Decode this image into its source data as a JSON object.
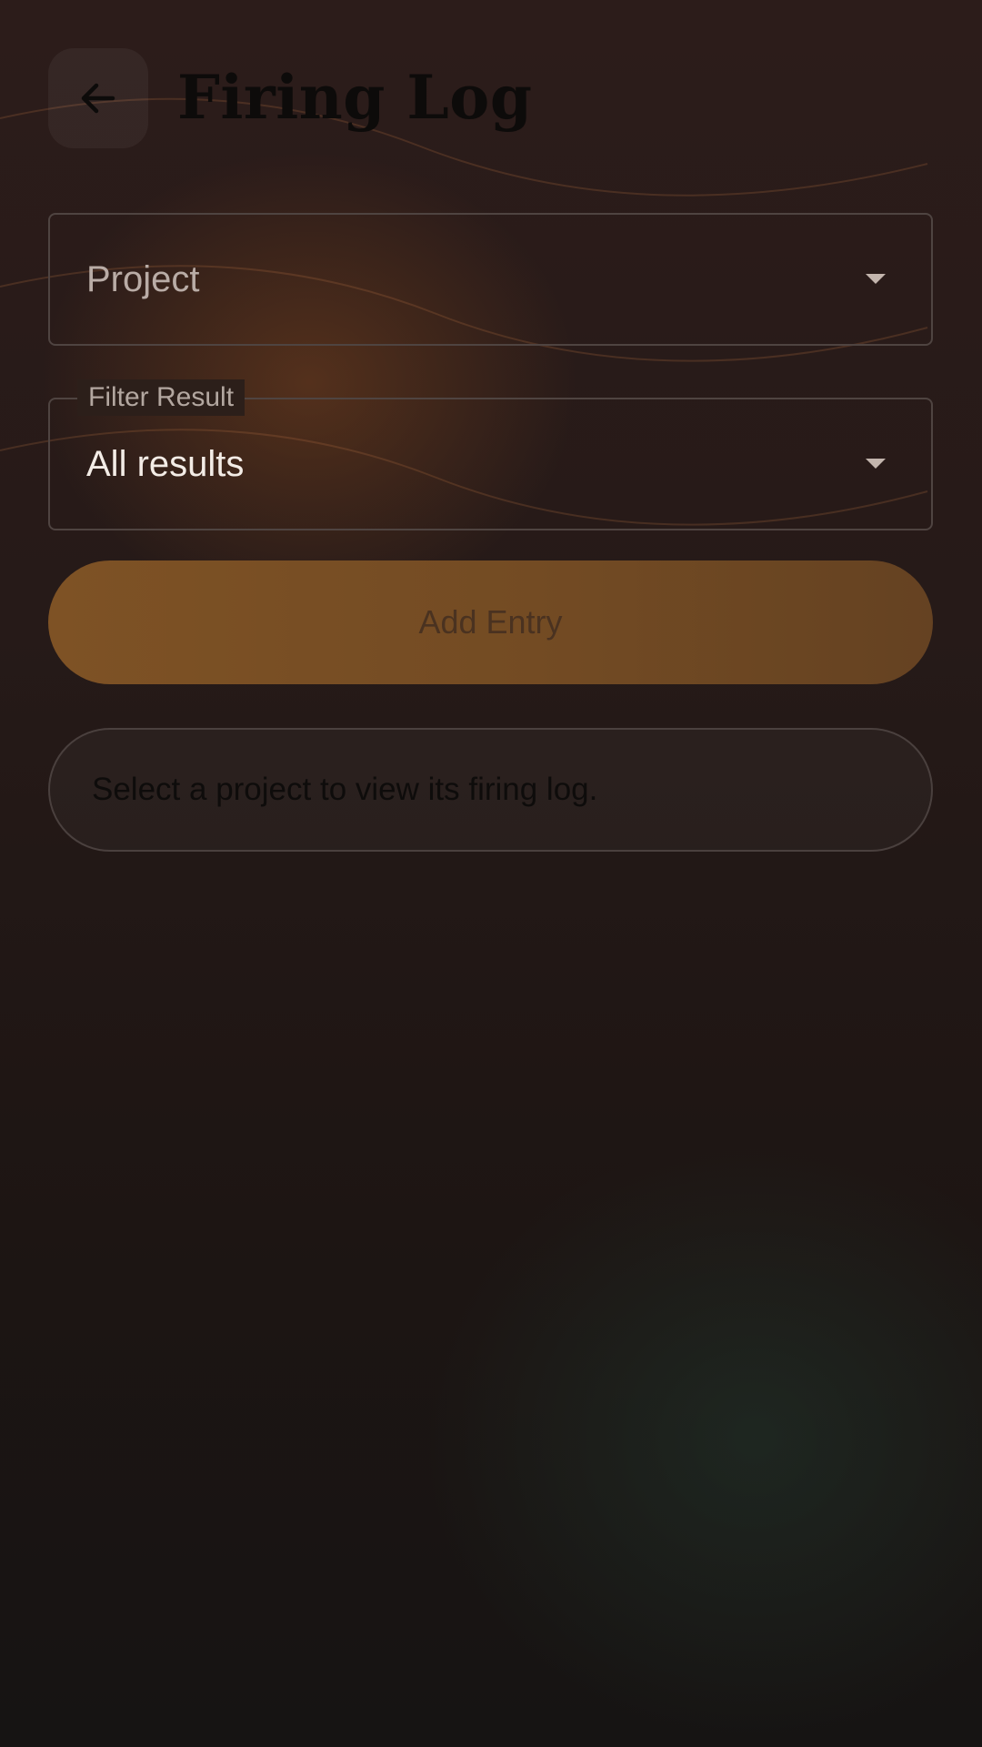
{
  "header": {
    "title": "Firing Log",
    "back_icon": "arrow-left-icon"
  },
  "form": {
    "project": {
      "placeholder": "Project",
      "icon": "chevron-down-icon"
    },
    "filter": {
      "label": "Filter Result",
      "value": "All results",
      "icon": "chevron-down-icon"
    },
    "add_entry_label": "Add Entry"
  },
  "info": {
    "message": "Select a project to view its firing log."
  },
  "colors": {
    "accent": "#7e5225",
    "background_top": "#2c1c1a",
    "background_bottom": "#161413"
  }
}
